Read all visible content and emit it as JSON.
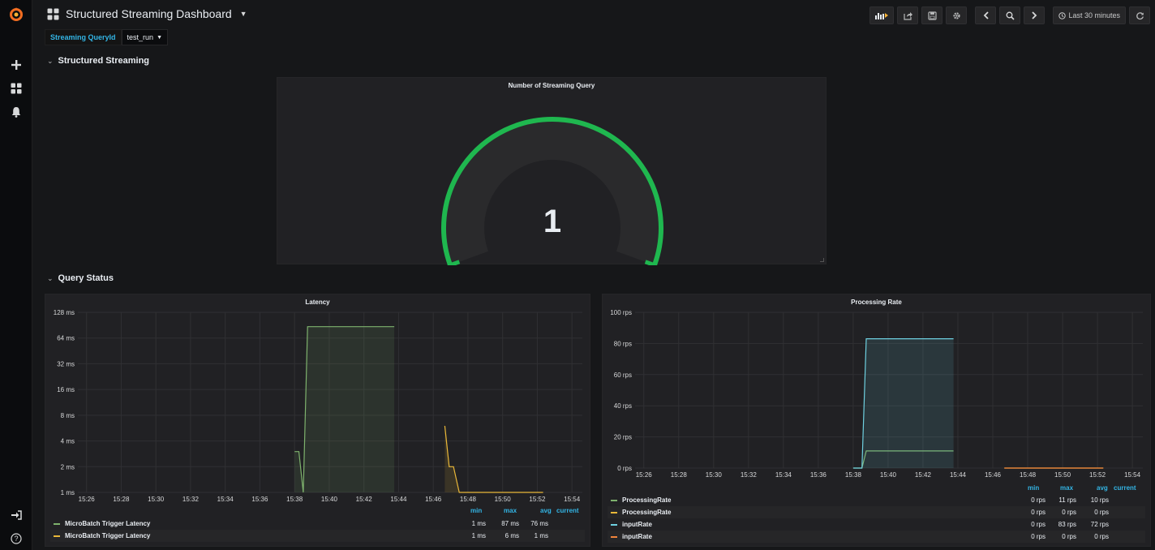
{
  "dashboard": {
    "title": "Structured Streaming Dashboard"
  },
  "toolbar": {
    "time_range": "Last 30 minutes"
  },
  "icons": {
    "logo": "grafana-logo",
    "plus": "plus-icon",
    "dashboards": "dashboards-icon",
    "alerts": "bell-icon",
    "signin": "sign-in-icon",
    "help": "help-icon",
    "add_panel": "add-panel-icon",
    "share": "share-icon",
    "save": "save-icon",
    "settings": "gear-icon",
    "back": "chevron-left-icon",
    "zoom": "zoom-out-icon",
    "forward": "chevron-right-icon",
    "clock": "clock-icon",
    "refresh": "refresh-icon"
  },
  "colors": {
    "accent": "#33b5e5",
    "green": "#7eb26d",
    "yellow": "#eab839",
    "cyan": "#6ed0e0",
    "orange": "#ef843c",
    "gauge": "#1fb74f"
  },
  "variables": {
    "label": "Streaming QueryId",
    "value": "test_run"
  },
  "rows": [
    {
      "title": "Structured Streaming"
    },
    {
      "title": "Query Status"
    }
  ],
  "gauge_panel": {
    "title": "Number of Streaming Query",
    "value": "1"
  },
  "latency_panel": {
    "title": "Latency",
    "legend_headers": [
      "min",
      "max",
      "avg",
      "current"
    ],
    "legend": [
      {
        "name": "MicroBatch Trigger Latency",
        "color": "#7eb26d",
        "min": "1 ms",
        "max": "87 ms",
        "avg": "76 ms",
        "current": ""
      },
      {
        "name": "MicroBatch Trigger Latency",
        "color": "#eab839",
        "min": "1 ms",
        "max": "6 ms",
        "avg": "1 ms",
        "current": ""
      }
    ]
  },
  "rate_panel": {
    "title": "Processing Rate",
    "legend_headers": [
      "min",
      "max",
      "avg",
      "current"
    ],
    "legend": [
      {
        "name": "ProcessingRate",
        "color": "#7eb26d",
        "min": "0 rps",
        "max": "11 rps",
        "avg": "10 rps",
        "current": ""
      },
      {
        "name": "ProcessingRate",
        "color": "#eab839",
        "min": "0 rps",
        "max": "0 rps",
        "avg": "0 rps",
        "current": ""
      },
      {
        "name": "inputRate",
        "color": "#6ed0e0",
        "min": "0 rps",
        "max": "83 rps",
        "avg": "72 rps",
        "current": ""
      },
      {
        "name": "inputRate",
        "color": "#ef843c",
        "min": "0 rps",
        "max": "0 rps",
        "avg": "0 rps",
        "current": ""
      }
    ]
  },
  "chart_data": [
    {
      "type": "gauge",
      "title": "Number of Streaming Query",
      "value": 1
    },
    {
      "type": "line",
      "title": "Latency",
      "yscale": "log2",
      "ylim": [
        1,
        128
      ],
      "y_ticks": [
        "1 ms",
        "2 ms",
        "4 ms",
        "8 ms",
        "16 ms",
        "32 ms",
        "64 ms",
        "128 ms"
      ],
      "y_tick_values": [
        1,
        2,
        4,
        8,
        16,
        32,
        64,
        128
      ],
      "x_ticks": [
        "15:26",
        "15:28",
        "15:30",
        "15:32",
        "15:34",
        "15:36",
        "15:38",
        "15:40",
        "15:42",
        "15:44",
        "15:46",
        "15:48",
        "15:50",
        "15:52",
        "15:54"
      ],
      "series": [
        {
          "name": "MicroBatch Trigger Latency",
          "color": "#7eb26d",
          "fill": true,
          "points": [
            [
              "15:38:00",
              3
            ],
            [
              "15:38:15",
              3
            ],
            [
              "15:38:30",
              1
            ],
            [
              "15:38:45",
              87
            ],
            [
              "15:40",
              87
            ],
            [
              "15:42",
              87
            ],
            [
              "15:43:45",
              87
            ]
          ]
        },
        {
          "name": "MicroBatch Trigger Latency",
          "color": "#eab839",
          "fill": true,
          "points": [
            [
              "15:46:40",
              6
            ],
            [
              "15:46:55",
              2
            ],
            [
              "15:47:10",
              2
            ],
            [
              "15:47:30",
              1
            ],
            [
              "15:50",
              1
            ],
            [
              "15:52:20",
              1
            ]
          ]
        }
      ]
    },
    {
      "type": "line",
      "title": "Processing Rate",
      "ylim": [
        0,
        100
      ],
      "y_ticks": [
        "0 rps",
        "20 rps",
        "40 rps",
        "60 rps",
        "80 rps",
        "100 rps"
      ],
      "y_tick_values": [
        0,
        20,
        40,
        60,
        80,
        100
      ],
      "x_ticks": [
        "15:26",
        "15:28",
        "15:30",
        "15:32",
        "15:34",
        "15:36",
        "15:38",
        "15:40",
        "15:42",
        "15:44",
        "15:46",
        "15:48",
        "15:50",
        "15:52",
        "15:54"
      ],
      "series": [
        {
          "name": "ProcessingRate",
          "color": "#7eb26d",
          "fill": false,
          "points": [
            [
              "15:38:00",
              0
            ],
            [
              "15:38:30",
              0
            ],
            [
              "15:38:45",
              11
            ],
            [
              "15:42",
              11
            ],
            [
              "15:43:45",
              11
            ]
          ]
        },
        {
          "name": "ProcessingRate",
          "color": "#eab839",
          "fill": false,
          "points": [
            [
              "15:46:40",
              0
            ],
            [
              "15:52:20",
              0
            ]
          ]
        },
        {
          "name": "inputRate",
          "color": "#6ed0e0",
          "fill": true,
          "points": [
            [
              "15:38:00",
              0
            ],
            [
              "15:38:30",
              0
            ],
            [
              "15:38:45",
              83
            ],
            [
              "15:42",
              83
            ],
            [
              "15:43:45",
              83
            ]
          ]
        },
        {
          "name": "inputRate",
          "color": "#ef843c",
          "fill": false,
          "points": [
            [
              "15:46:40",
              0
            ],
            [
              "15:52:20",
              0
            ]
          ]
        }
      ]
    }
  ]
}
